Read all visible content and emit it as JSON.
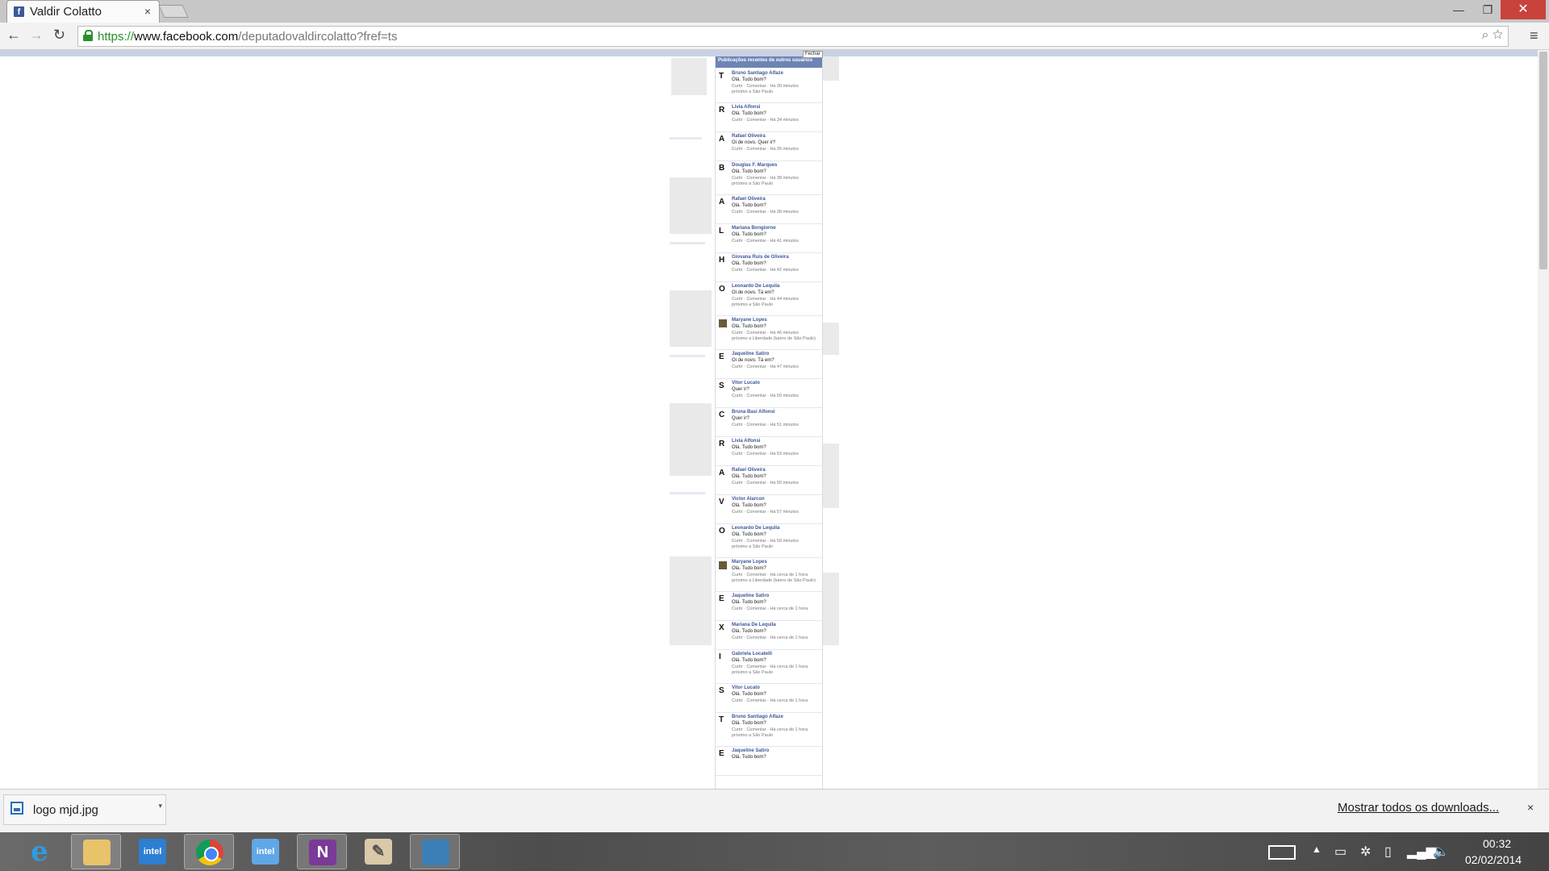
{
  "browser": {
    "tab_title": "Valdir Colatto",
    "tab_favicon": "f",
    "tab_close": "×",
    "url_scheme": "https://",
    "url_host": "www.facebook.com",
    "url_path": "/deputadovaldircolatto?fref=ts",
    "window_buttons": {
      "minimize": "—",
      "maximize": "❐",
      "close": "✕"
    },
    "nav": {
      "back": "←",
      "forward": "→",
      "reload": "↻",
      "menu": "≡"
    },
    "omnibox_icons": "⌕ ☆"
  },
  "ticker": {
    "header": "Publicações recentes de outros usuários",
    "close_label": "Fechar",
    "items": [
      {
        "avatar": "T",
        "name": "Bruno Santiago Alfaze",
        "text": "Olá. Tudo bom?",
        "meta": "Curtir · Comentar · Há 30 minutos",
        "location": "próximo a São Paulo"
      },
      {
        "avatar": "R",
        "name": "Livia Alfonsi",
        "text": "Olá. Tudo bom?",
        "meta": "Curtir · Comentar · Há 34 minutos",
        "location": ""
      },
      {
        "avatar": "A",
        "name": "Rafael Oliveira",
        "text": "Oi de novo. Quer ir?",
        "meta": "Curtir · Comentar · Há 35 minutos",
        "location": ""
      },
      {
        "avatar": "B",
        "name": "Douglas F. Marques",
        "text": "Olá. Tudo bom?",
        "meta": "Curtir · Comentar · Há 38 minutos",
        "location": "próximo a São Paulo"
      },
      {
        "avatar": "A",
        "name": "Rafael Oliveira",
        "text": "Olá. Tudo bom?",
        "meta": "Curtir · Comentar · Há 38 minutos",
        "location": ""
      },
      {
        "avatar": "L",
        "name": "Mariana Bongiorno",
        "text": "Olá. Tudo bom?",
        "meta": "Curtir · Comentar · Há 41 minutos",
        "location": ""
      },
      {
        "avatar": "H",
        "name": "Giovana Ruis de Oliveira",
        "text": "Olá. Tudo bom?",
        "meta": "Curtir · Comentar · Há 42 minutos",
        "location": ""
      },
      {
        "avatar": "O",
        "name": "Leonardo De Lequila",
        "text": "Oi de novo. Tá em?",
        "meta": "Curtir · Comentar · Há 44 minutos",
        "location": "próximo a São Paulo"
      },
      {
        "avatar": "",
        "name": "Maryane Lopes",
        "text": "Olá. Tudo bom?",
        "meta": "Curtir · Comentar · Há 46 minutos",
        "location": "próximo a Liberdade (bairro de São Paulo)"
      },
      {
        "avatar": "E",
        "name": "Jaqueline Satiro",
        "text": "Oi de novo. Tá em?",
        "meta": "Curtir · Comentar · Há 47 minutos",
        "location": ""
      },
      {
        "avatar": "S",
        "name": "Vitor Lucato",
        "text": "Quer ir?",
        "meta": "Curtir · Comentar · Há 50 minutos",
        "location": ""
      },
      {
        "avatar": "C",
        "name": "Bruna Basi Alfonsi",
        "text": "Quer ir?",
        "meta": "Curtir · Comentar · Há 51 minutos",
        "location": ""
      },
      {
        "avatar": "R",
        "name": "Livia Alfonsi",
        "text": "Olá. Tudo bom?",
        "meta": "Curtir · Comentar · Há 53 minutos",
        "location": ""
      },
      {
        "avatar": "A",
        "name": "Rafael Oliveira",
        "text": "Olá. Tudo bom?",
        "meta": "Curtir · Comentar · Há 55 minutos",
        "location": ""
      },
      {
        "avatar": "V",
        "name": "Victor Alarcon",
        "text": "Olá. Tudo bom?",
        "meta": "Curtir · Comentar · Há 57 minutos",
        "location": ""
      },
      {
        "avatar": "O",
        "name": "Leonardo De Lequila",
        "text": "Olá. Tudo bom?",
        "meta": "Curtir · Comentar · Há 59 minutos",
        "location": "próximo a São Paulo"
      },
      {
        "avatar": "",
        "name": "Maryane Lopes",
        "text": "Olá. Tudo bom?",
        "meta": "Curtir · Comentar · Há cerca de 1 hora",
        "location": "próximo a Liberdade (bairro de São Paulo)"
      },
      {
        "avatar": "E",
        "name": "Jaqueline Satiro",
        "text": "Olá. Tudo bom?",
        "meta": "Curtir · Comentar · Há cerca de 1 hora",
        "location": ""
      },
      {
        "avatar": "X",
        "name": "Mariana De Lequila",
        "text": "Olá. Tudo bom?",
        "meta": "Curtir · Comentar · Há cerca de 1 hora",
        "location": ""
      },
      {
        "avatar": "I",
        "name": "Gabriela Locatelli",
        "text": "Olá. Tudo bom?",
        "meta": "Curtir · Comentar · Há cerca de 1 hora",
        "location": "próximo a São Paulo"
      },
      {
        "avatar": "S",
        "name": "Vitor Lucato",
        "text": "Olá. Tudo bom?",
        "meta": "Curtir · Comentar · Há cerca de 1 hora",
        "location": ""
      },
      {
        "avatar": "T",
        "name": "Bruno Santiago Alfaze",
        "text": "Olá. Tudo bom?",
        "meta": "Curtir · Comentar · Há cerca de 1 hora",
        "location": "próximo a São Paulo"
      },
      {
        "avatar": "E",
        "name": "Jaqueline Satiro",
        "text": "Olá. Tudo bom?",
        "meta": "",
        "location": ""
      }
    ]
  },
  "downloads": {
    "file_name": "logo mjd.jpg",
    "show_all": "Mostrar todos os downloads...",
    "close": "×",
    "arrow": "▾"
  },
  "taskbar": {
    "apps": [
      {
        "name": "internet-explorer",
        "glyph": "e"
      },
      {
        "name": "file-explorer",
        "glyph": ""
      },
      {
        "name": "intel-app",
        "glyph": "intel"
      },
      {
        "name": "chrome",
        "glyph": ""
      },
      {
        "name": "intel-graphics",
        "glyph": "intel"
      },
      {
        "name": "onenote-clipping",
        "glyph": "N"
      },
      {
        "name": "paint",
        "glyph": "✎"
      },
      {
        "name": "photo-viewer",
        "glyph": ""
      }
    ],
    "clock_time": "00:32",
    "clock_date": "02/02/2014"
  }
}
